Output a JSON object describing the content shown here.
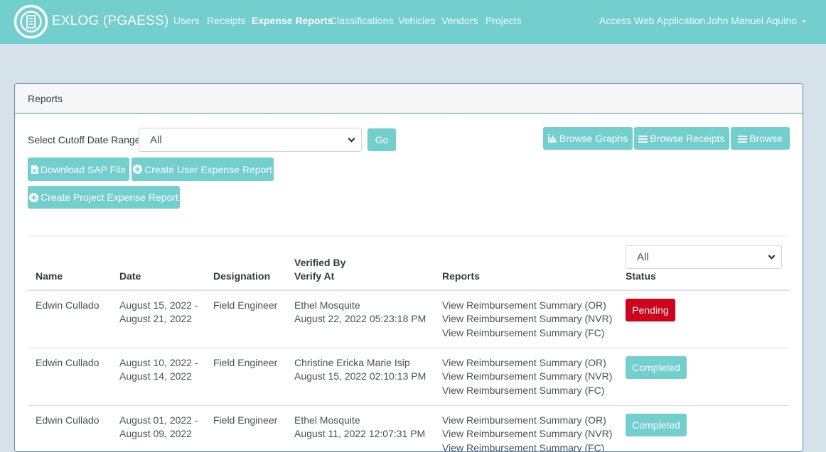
{
  "nav": {
    "brand": "EXLOG (PGAESS)",
    "items": [
      {
        "label": "Users"
      },
      {
        "label": "Receipts"
      },
      {
        "label": "Expense Reports"
      },
      {
        "label": "Classifications"
      },
      {
        "label": "Vehicles"
      },
      {
        "label": "Vendors"
      },
      {
        "label": "Projects"
      }
    ],
    "access_web": "Access Web Application",
    "user_name": "John Manuel Aquino"
  },
  "card": {
    "title": "Reports",
    "cutoff_label": "Select Cutoff Date Range:",
    "cutoff_value": "All",
    "go_label": "Go",
    "browse_graphs": "Browse Graphs",
    "browse_receipts": "Browse Receipts",
    "browse": "Browse",
    "download_sap": "Download SAP File",
    "create_user_report": "Create User Expense Report",
    "create_project_report": "Create Project Expense Report"
  },
  "table": {
    "status_filter": "All",
    "headers": {
      "name": "Name",
      "date": "Date",
      "designation": "Designation",
      "verified_by": "Verified By",
      "verify_at": "Verify At",
      "reports": "Reports",
      "status": "Status"
    },
    "rows": [
      {
        "name": "Edwin Cullado",
        "date_start": "August 15, 2022 -",
        "date_end": "August 21, 2022",
        "designation": "Field Engineer",
        "verified_by": "Ethel Mosquite",
        "verify_at": "August 22, 2022 05:23:18 PM",
        "report_or": "View Reimbursement Summary (OR)",
        "report_nvr": "View Reimbursement Summary (NVR)",
        "report_fc": "View Reimbursement Summary (FC)",
        "status": "Pending"
      },
      {
        "name": "Edwin Cullado",
        "date_start": "August 10, 2022 -",
        "date_end": "August 14, 2022",
        "designation": "Field Engineer",
        "verified_by": "Christine Ericka Marie Isip",
        "verify_at": "August 15, 2022 02:10:13 PM",
        "report_or": "View Reimbursement Summary (OR)",
        "report_nvr": "View Reimbursement Summary (NVR)",
        "report_fc": "View Reimbursement Summary (FC)",
        "status": "Completed"
      },
      {
        "name": "Edwin Cullado",
        "date_start": "August 01, 2022 -",
        "date_end": "August 09, 2022",
        "designation": "Field Engineer",
        "verified_by": "Ethel Mosquite",
        "verify_at": "August 11, 2022 12:07:31 PM",
        "report_or": "View Reimbursement Summary (OR)",
        "report_nvr": "View Reimbursement Summary (NVR)",
        "report_fc": "View Reimbursement Summary (FC)",
        "status": "Completed"
      }
    ]
  },
  "colors": {
    "navbar": "#72cfcd",
    "pending": "#d0021b",
    "completed": "#72cfcd",
    "background": "#d6e2ea"
  },
  "icons": [
    "logo-icon",
    "bar-chart-icon",
    "list-icon",
    "file-icon",
    "plus-circle-icon",
    "chevron-down-icon"
  ]
}
